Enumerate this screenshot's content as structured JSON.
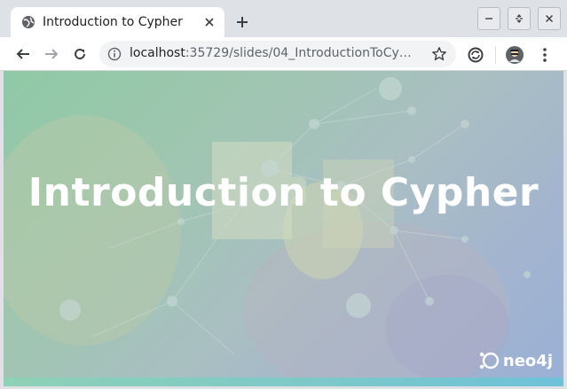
{
  "tab": {
    "title": "Introduction to Cypher",
    "favicon": "globe-icon"
  },
  "window_controls": {
    "minimize": "minimize-icon",
    "maximize": "maximize-icon",
    "close": "close-icon"
  },
  "toolbar": {
    "url_host": "localhost",
    "url_path": ":35729/slides/04_IntroductionToCy…"
  },
  "slide": {
    "title": "Introduction to Cypher",
    "logo_text": "neo4j"
  },
  "colors": {
    "tab_strip": "#dee1e6",
    "slide_green": "#8fc9a5",
    "slide_blue": "#9ab0d6",
    "bottom_bar": "#6ec2d8"
  }
}
